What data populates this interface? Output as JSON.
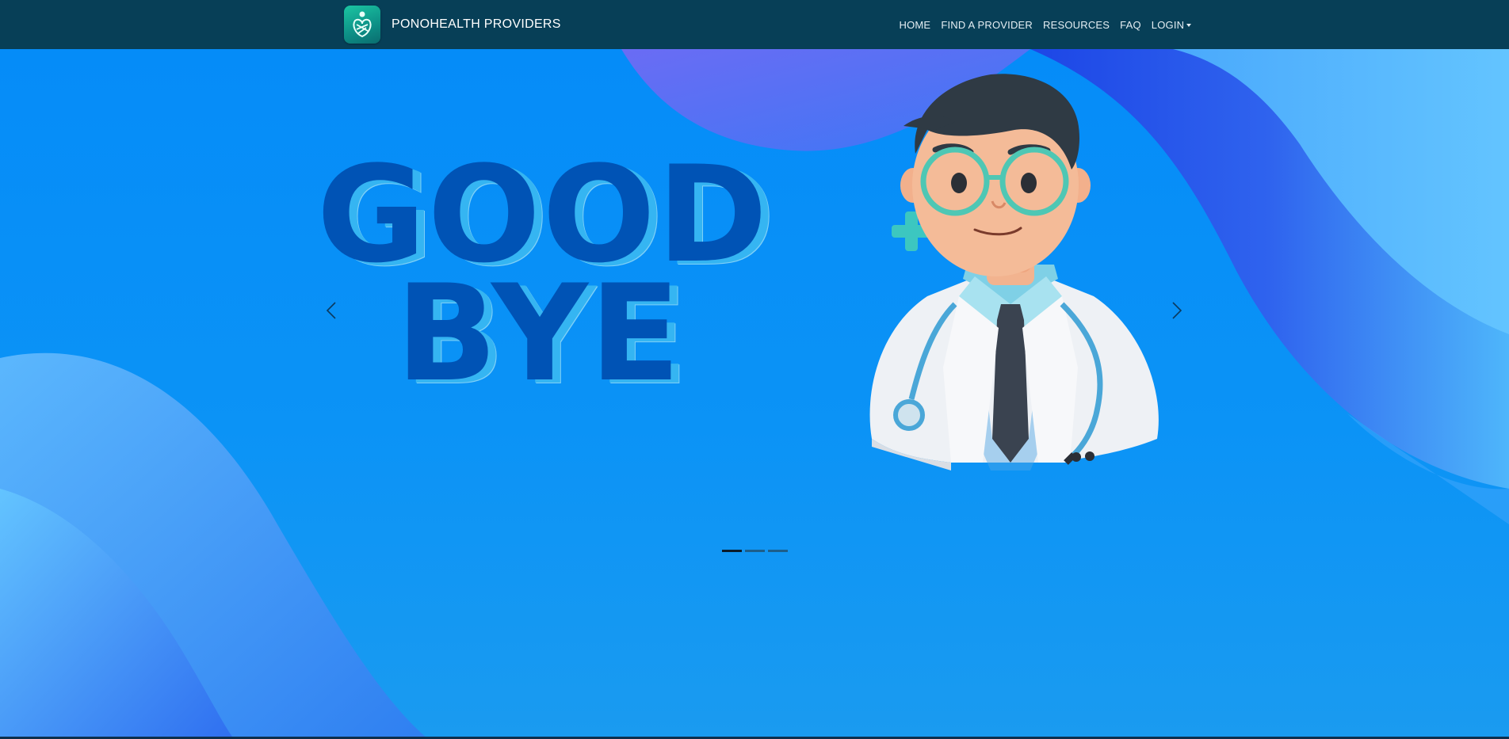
{
  "navbar": {
    "brand_name": "PONOHEALTH PROVIDERS",
    "logo_icon": "hands-heart-logo-icon",
    "links": [
      {
        "label": "HOME"
      },
      {
        "label": "FIND A PROVIDER"
      },
      {
        "label": "RESOURCES"
      },
      {
        "label": "FAQ"
      },
      {
        "label": "LOGIN"
      }
    ]
  },
  "hero": {
    "headline_line1": "GOOD",
    "headline_line2": "BYE",
    "prev_icon": "chevron-left-icon",
    "next_icon": "chevron-right-icon",
    "slides_total": 3,
    "active_slide": 1
  },
  "colors": {
    "navbar_bg": "#073f57",
    "hero_bg": "#0a8ff5",
    "headline": "#0053b5",
    "headline_shadow": "#35b5f2"
  }
}
